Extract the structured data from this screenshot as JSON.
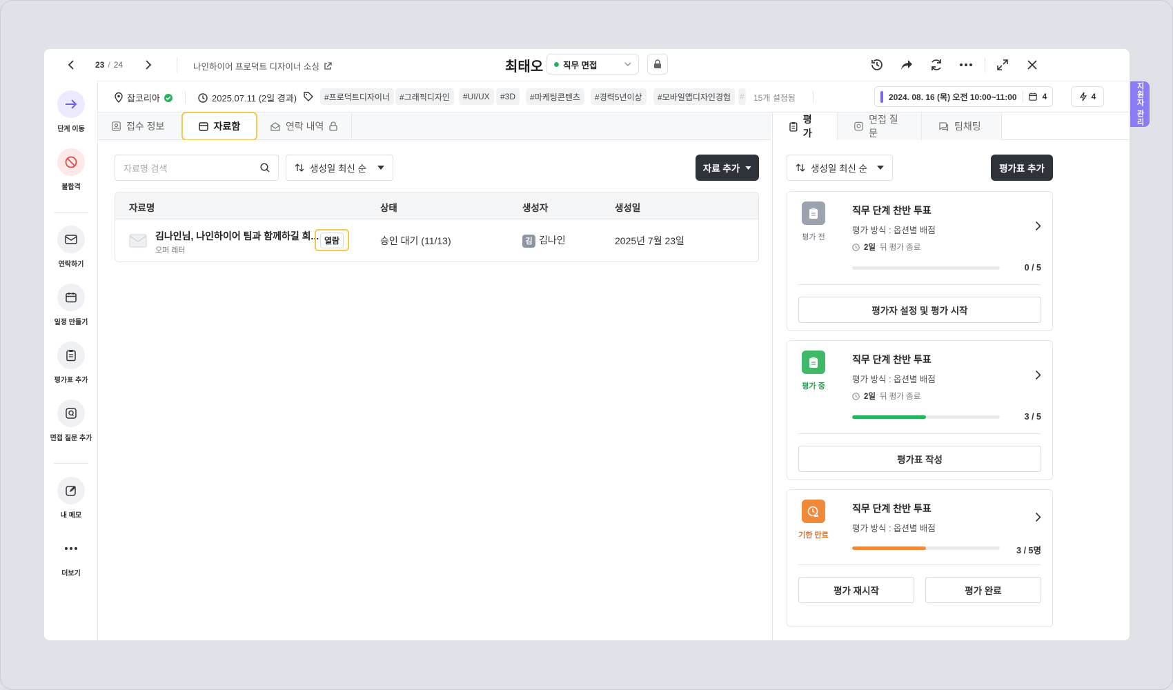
{
  "nav": {
    "current": "23",
    "total": "24",
    "job_link": "나인하이어 프로덕트 디자이너 소싱"
  },
  "candidate": {
    "name": "최태오",
    "stage": "직무 면접"
  },
  "sidebar": [
    {
      "label": "단계 이동",
      "icon": "arrow-right-icon"
    },
    {
      "label": "불합격",
      "icon": "ban-icon"
    },
    {
      "label": "연락하기",
      "icon": "mail-icon"
    },
    {
      "label": "일정 만들기",
      "icon": "calendar-icon"
    },
    {
      "label": "평가표 추가",
      "icon": "clipboard-icon"
    },
    {
      "label": "면접 질문 추가",
      "icon": "question-icon"
    },
    {
      "label": "내 메모",
      "icon": "edit-icon"
    },
    {
      "label": "더보기",
      "icon": "more-icon"
    }
  ],
  "meta": {
    "source": "잡코리아",
    "date": "2025.07.11 (2일 경과)",
    "tags": [
      "#프로덕트디자이너",
      "#그래픽디자인",
      "#UI/UX",
      "#3D",
      "#마케팅콘텐츠",
      "#경력5년이상",
      "#모바일앱디자인경험"
    ],
    "more_tags": "15개 설정됨",
    "schedule": "2024. 08. 16 (목) 오전 10:00~11:00",
    "calendar_count": "4",
    "bolt_count": "4"
  },
  "side_tab": "지원자 관리",
  "tabs": [
    {
      "label": "접수 정보"
    },
    {
      "label": "자료함"
    },
    {
      "label": "연락 내역"
    }
  ],
  "materials": {
    "search_placeholder": "자료명 검색",
    "sort": "생성일 최신 순",
    "add_button": "자료 추가",
    "columns": [
      "자료명",
      "상태",
      "생성자",
      "생성일"
    ],
    "rows": [
      {
        "title": "김나인님, 나인하이어 팀과 함께하길 희...",
        "subtitle": "오퍼 레터",
        "badge": "열람",
        "status": "승인 대기 (11/13)",
        "creator_initial": "김",
        "creator": "김나인",
        "created": "2025년 7월 23일"
      }
    ]
  },
  "right_tabs": [
    {
      "label": "평가"
    },
    {
      "label": "면접 질문"
    },
    {
      "label": "팀채팅"
    }
  ],
  "evaluation": {
    "sort": "생성일 최신 순",
    "add_button": "평가표 추가",
    "cards": [
      {
        "status": "평가 전",
        "status_color": "#6b7280",
        "icon_bg": "#9ca3af",
        "title": "직무 단계 찬반 투표",
        "method": "평가 방식 : 옵션별 배점",
        "deadline_num": "2일",
        "deadline_rest": "뒤 평가 종료",
        "progress": 0,
        "progress_color": "#22b45b",
        "count": "0 / 5",
        "buttons": [
          "평가자 설정 및 평가 시작"
        ]
      },
      {
        "status": "평가 중",
        "status_color": "#22a352",
        "icon_bg": "#3fb867",
        "title": "직무 단계 찬반 투표",
        "method": "평가 방식 : 옵션별 배점",
        "deadline_num": "2일",
        "deadline_rest": "뒤 평가 종료",
        "progress": 0.5,
        "progress_color": "#22b45b",
        "count": "3 / 5",
        "buttons": [
          "평가표 작성"
        ]
      },
      {
        "status": "기한 만료",
        "status_color": "#e2711d",
        "icon_bg": "#f08a3a",
        "title": "직무 단계 찬반 투표",
        "method": "평가 방식 : 옵션별 배점",
        "progress": 0.5,
        "progress_color": "#f08a3a",
        "count": "3 / 5명",
        "buttons": [
          "평가 재시작",
          "평가 완료"
        ]
      }
    ]
  }
}
